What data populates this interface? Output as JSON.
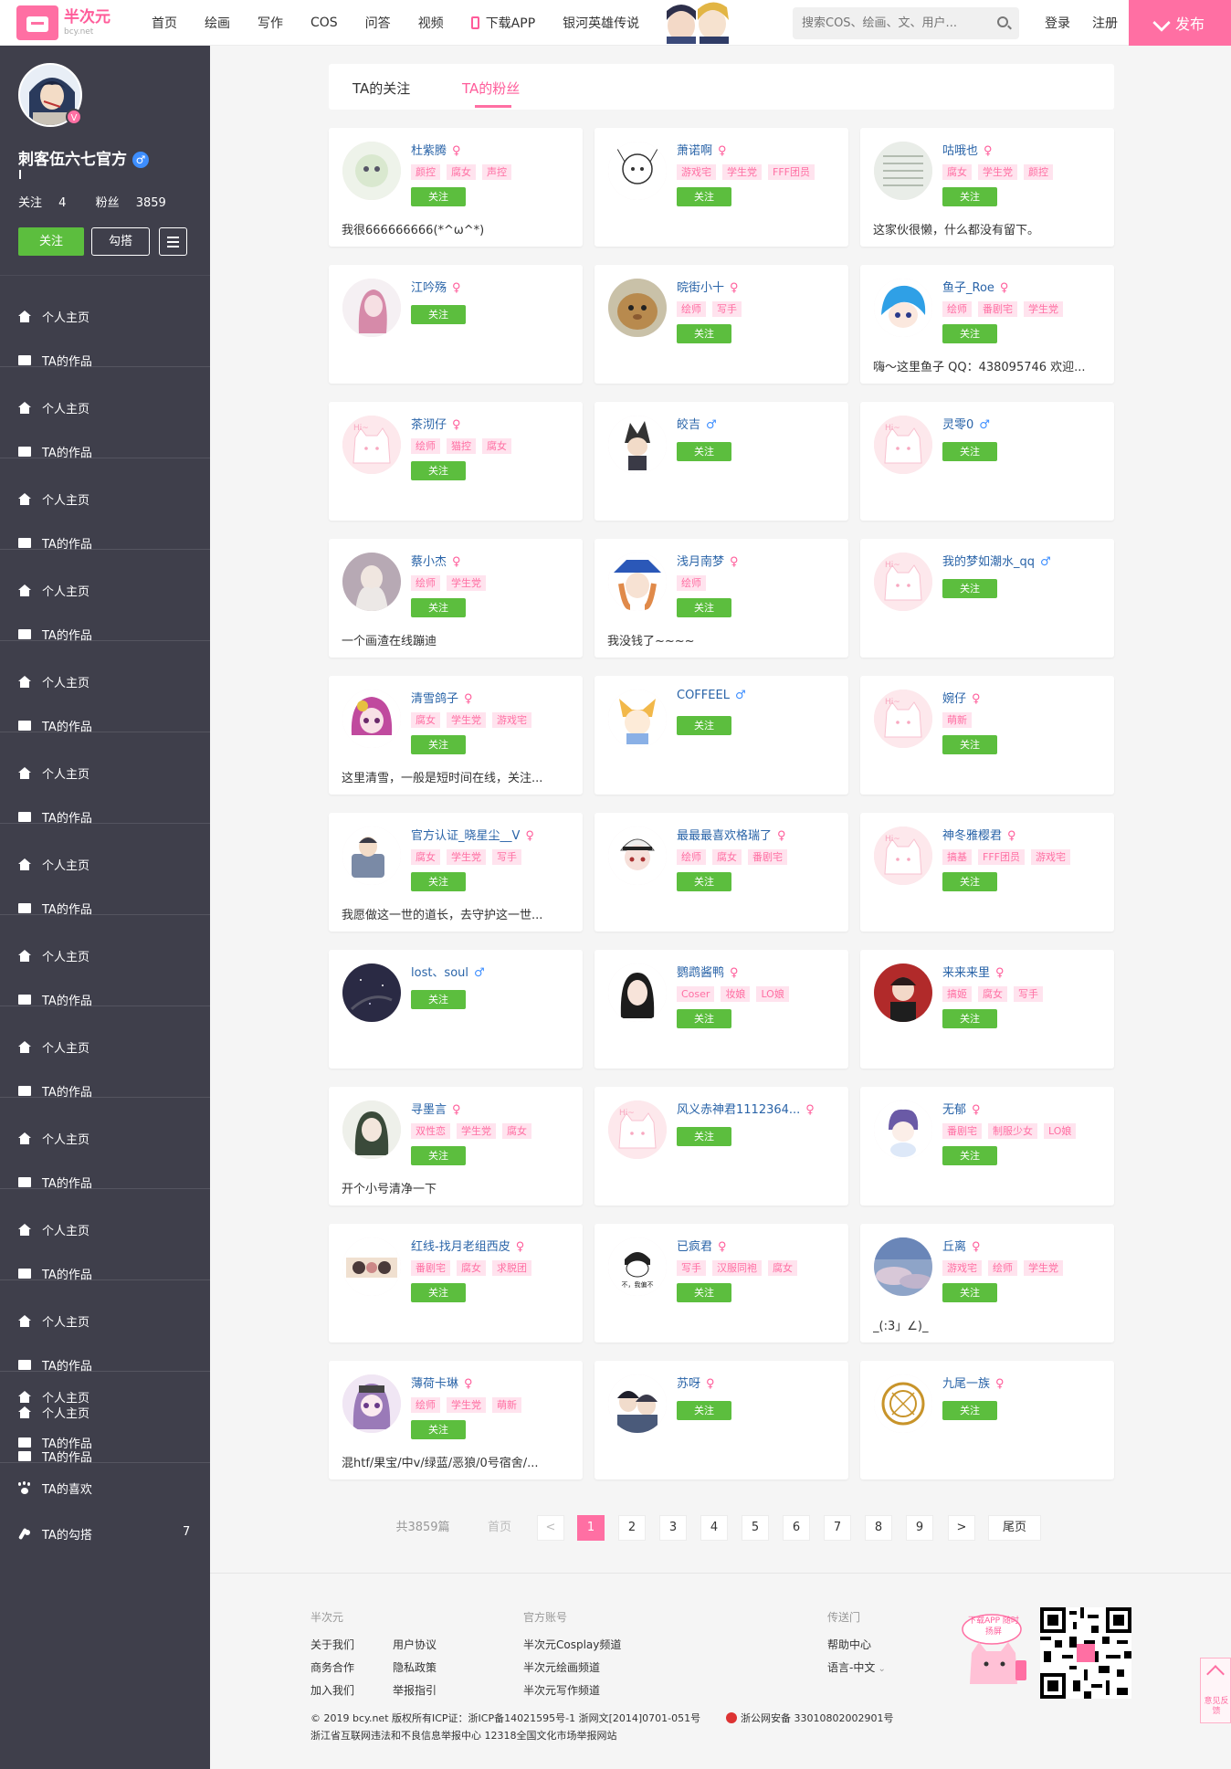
{
  "header": {
    "logo_title": "半次元",
    "logo_sub": "bcy.net",
    "nav": [
      "首页",
      "绘画",
      "写作",
      "COS",
      "问答",
      "视频"
    ],
    "download_app": "下载APP",
    "game_link": "银河英雄传说",
    "search_placeholder": "搜索COS、绘画、文、用户...",
    "login": "登录",
    "register": "注册",
    "publish": "发布"
  },
  "profile": {
    "name": "刺客伍六七官方",
    "gender_symbol": "♂",
    "verified_badge": "V",
    "following_label": "关注",
    "following_count": "4",
    "fans_label": "粉丝",
    "fans_count": "3859",
    "follow_button": "关注",
    "gouda_button": "勾搭"
  },
  "sidebar": {
    "repeat_home": "个人主页",
    "repeat_works": "TA的作品",
    "items": [
      {
        "label": "个人主页",
        "icon": "home-icon"
      },
      {
        "label": "TA的作品",
        "icon": "folder-icon"
      },
      {
        "label": "TA的喜欢",
        "icon": "paw-icon"
      },
      {
        "label": "TA的勾搭",
        "icon": "feather-icon",
        "count": "7"
      }
    ]
  },
  "tabs": {
    "following": "TA的关注",
    "fans": "TA的粉丝"
  },
  "follow_label": "关注",
  "fans": [
    {
      "name": "杜紫腾",
      "gender": "♀",
      "tags": [
        "颜控",
        "腐女",
        "声控"
      ],
      "bio": "我很666666666(*^ω^*)"
    },
    {
      "name": "萧诺啊",
      "gender": "♀",
      "tags": [
        "游戏宅",
        "学生党",
        "FFF团员"
      ],
      "bio": ""
    },
    {
      "name": "咕哦也",
      "gender": "♀",
      "tags": [
        "腐女",
        "学生党",
        "颜控"
      ],
      "bio": "这家伙很懒，什么都没有留下。"
    },
    {
      "name": "江吟殇",
      "gender": "♀",
      "tags": [],
      "bio": ""
    },
    {
      "name": "晥街小十",
      "gender": "♀",
      "tags": [
        "绘师",
        "写手"
      ],
      "bio": ""
    },
    {
      "name": "鱼子_Roe",
      "gender": "♀",
      "tags": [
        "绘师",
        "番剧宅",
        "学生党"
      ],
      "bio": "嗨～这里鱼子 QQ：438095746 欢迎..."
    },
    {
      "name": "茶沏仔",
      "gender": "♀",
      "tags": [
        "绘师",
        "猫控",
        "腐女"
      ],
      "bio": ""
    },
    {
      "name": "皎吉",
      "gender": "♂",
      "tags": [],
      "bio": ""
    },
    {
      "name": "灵零0",
      "gender": "♂",
      "tags": [],
      "bio": ""
    },
    {
      "name": "蔡小杰",
      "gender": "♀",
      "tags": [
        "绘师",
        "学生党"
      ],
      "bio": "一个画渣在线蹦迪"
    },
    {
      "name": "浅月南梦",
      "gender": "♀",
      "tags": [
        "绘师"
      ],
      "bio": "我没钱了~~~~"
    },
    {
      "name": "我的梦如潮水_qq",
      "gender": "♂",
      "tags": [],
      "bio": ""
    },
    {
      "name": "清雪鸽子",
      "gender": "♀",
      "tags": [
        "腐女",
        "学生党",
        "游戏宅"
      ],
      "bio": "这里清雪，一般是短时间在线，关注..."
    },
    {
      "name": "COFFEEL",
      "gender": "♂",
      "tags": [],
      "bio": ""
    },
    {
      "name": "婉仔",
      "gender": "♀",
      "tags": [
        "萌新"
      ],
      "bio": ""
    },
    {
      "name": "官方认证_晓星尘__V",
      "gender": "♀",
      "tags": [
        "腐女",
        "学生党",
        "写手"
      ],
      "bio": "我愿做这一世的道长，去守护这一世..."
    },
    {
      "name": "最最最喜欢格瑞了",
      "gender": "♀",
      "tags": [
        "绘师",
        "腐女",
        "番剧宅"
      ],
      "bio": ""
    },
    {
      "name": "神冬雅樱君",
      "gender": "♀",
      "tags": [
        "搞基",
        "FFF团员",
        "游戏宅"
      ],
      "bio": ""
    },
    {
      "name": "lost、soul",
      "gender": "♂",
      "tags": [],
      "bio": ""
    },
    {
      "name": "鹦鹉酱鸭",
      "gender": "♀",
      "tags": [
        "Coser",
        "妆娘",
        "LO娘"
      ],
      "bio": ""
    },
    {
      "name": "来来来里",
      "gender": "♀",
      "tags": [
        "搞姬",
        "腐女",
        "写手"
      ],
      "bio": ""
    },
    {
      "name": "寻墨言",
      "gender": "♀",
      "tags": [
        "双性恋",
        "学生党",
        "腐女"
      ],
      "bio": "开个小号清净一下"
    },
    {
      "name": "风义赤神君1112364...",
      "gender": "♀",
      "tags": [],
      "bio": ""
    },
    {
      "name": "无郁",
      "gender": "♀",
      "tags": [
        "番剧宅",
        "制服少女",
        "LO娘"
      ],
      "bio": ""
    },
    {
      "name": "红线-找月老组西皮",
      "gender": "♀",
      "tags": [
        "番剧宅",
        "腐女",
        "求脱团"
      ],
      "bio": ""
    },
    {
      "name": "已疯君",
      "gender": "♀",
      "tags": [
        "写手",
        "汉服同袍",
        "腐女"
      ],
      "bio": ""
    },
    {
      "name": "丘离",
      "gender": "♀",
      "tags": [
        "游戏宅",
        "绘师",
        "学生党"
      ],
      "bio": "_(:3」∠)_"
    },
    {
      "name": "薄荷卡琳",
      "gender": "♀",
      "tags": [
        "绘师",
        "学生党",
        "萌新"
      ],
      "bio": "混htf/果宝/中v/绿蓝/恶狼/0号宿舍/..."
    },
    {
      "name": "苏呀",
      "gender": "♀",
      "tags": [],
      "bio": ""
    },
    {
      "name": "九尾一族",
      "gender": "♀",
      "tags": [],
      "bio": ""
    }
  ],
  "pagination": {
    "total": "共3859篇",
    "first": "首页",
    "prev": "<",
    "pages": [
      "1",
      "2",
      "3",
      "4",
      "5",
      "6",
      "7",
      "8",
      "9"
    ],
    "current": "1",
    "next": ">",
    "last": "尾页"
  },
  "footer": {
    "col1_title": "半次元",
    "col1_links": [
      "关于我们",
      "用户协议",
      "商务合作",
      "隐私政策",
      "加入我们",
      "举报指引"
    ],
    "col2_title": "官方账号",
    "col2_links": [
      "半次元Cosplay频道",
      "半次元绘画频道",
      "半次元写作频道"
    ],
    "col3_title": "传送门",
    "col3_links": [
      "帮助中心",
      "语言-中文"
    ],
    "app_bubble": "下载APP 随时扬屏",
    "copyright": "© 2019 bcy.net 版权所有ICP证：浙ICP备14021595号-1 浙网文[2014]0701-051号",
    "police": "浙公网安备 33010802002901号",
    "report": "浙江省互联网违法和不良信息举报中心  12318全国文化市场举报网站",
    "feedback": "意见反馈"
  },
  "colors": {
    "brand_pink": "#ff6fa3",
    "follow_green": "#5cbe3e",
    "sidebar_bg": "#3f3f4b",
    "name_blue": "#2a64a8"
  }
}
